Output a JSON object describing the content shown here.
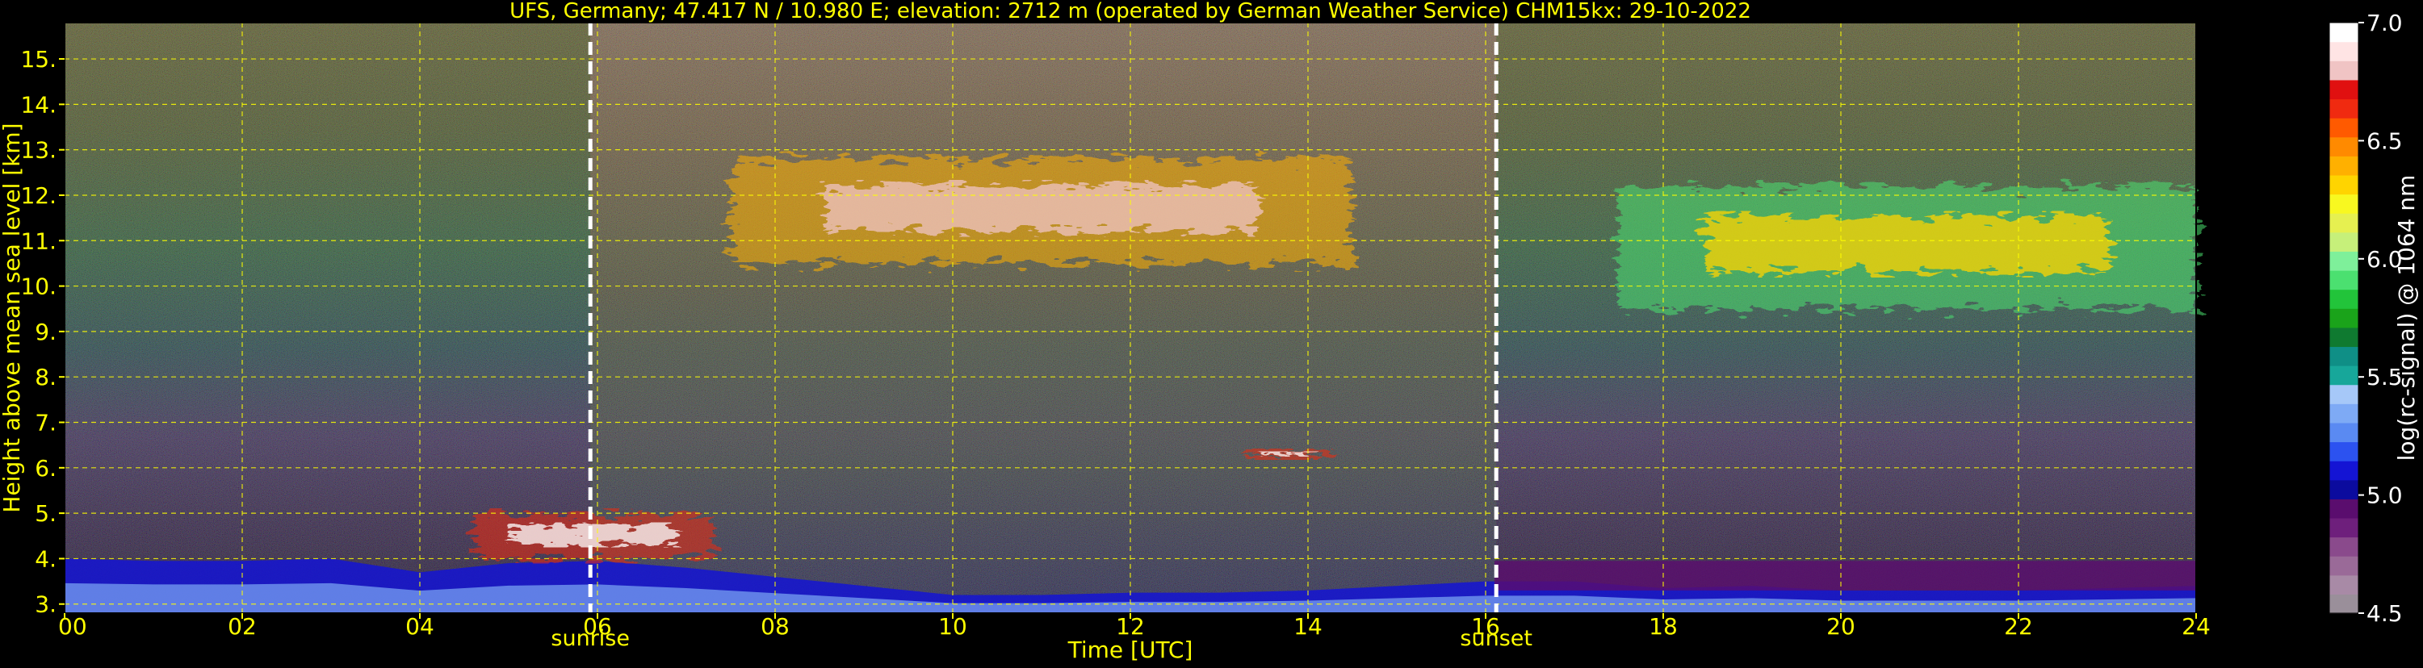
{
  "chart_data": {
    "type": "heatmap",
    "title": "UFS, Germany; 47.417 N / 10.980 E; elevation: 2712 m  (operated by German Weather Service)    CHM15kx: 29-10-2022",
    "xlabel": "Time [UTC]",
    "ylabel": "Height above mean sea level [km]",
    "xlim": [
      0,
      24
    ],
    "ylim": [
      2.8,
      15.8
    ],
    "x_ticks": [
      "00",
      "02",
      "04",
      "06",
      "08",
      "10",
      "12",
      "14",
      "16",
      "18",
      "20",
      "22",
      "24"
    ],
    "y_ticks": [
      "3.",
      "4.",
      "5.",
      "6.",
      "7.",
      "8.",
      "9.",
      "10.",
      "11.",
      "12.",
      "13.",
      "14.",
      "15."
    ],
    "grid": true,
    "markers": [
      {
        "label": "sunrise",
        "x": 5.92
      },
      {
        "label": "sunset",
        "x": 16.12
      }
    ],
    "colorbar": {
      "label": "log(rc-signal) @ 1064 nm",
      "range": [
        4.5,
        7.0
      ],
      "ticks": [
        "7.0",
        "6.5",
        "6.0",
        "5.5",
        "5.0",
        "4.5"
      ],
      "colors": [
        "#9a8f9a",
        "#a88aa6",
        "#9a6a98",
        "#8a4a8c",
        "#6e1f7c",
        "#5a0d6e",
        "#0b0b9e",
        "#1414d4",
        "#2c52f0",
        "#5a8af2",
        "#7eaaf5",
        "#a6c8f8",
        "#17a79a",
        "#0f8f86",
        "#0f7a30",
        "#1aa31a",
        "#22c43a",
        "#4be070",
        "#7ef09a",
        "#c6f07a",
        "#e6f050",
        "#f8f820",
        "#ffd400",
        "#ffb000",
        "#ff8a00",
        "#ff5a00",
        "#f02a10",
        "#e01010",
        "#f0c4c4",
        "#ffe4e4",
        "#ffffff"
      ]
    },
    "series": [
      {
        "x": [
          0,
          1,
          2,
          3,
          4,
          5,
          6,
          7,
          8,
          9,
          10,
          11,
          12,
          13,
          14,
          15,
          16,
          17,
          18,
          19,
          20,
          21,
          22,
          23,
          24
        ],
        "values": [
          4.0,
          3.95,
          3.95,
          4.0,
          3.7,
          3.9,
          3.95,
          3.8,
          3.6,
          3.4,
          3.2,
          3.2,
          3.25,
          3.25,
          3.3,
          3.4,
          3.5,
          3.5,
          3.35,
          3.4,
          3.3,
          3.3,
          3.3,
          3.35,
          3.4
        ]
      }
    ],
    "cloud_layers": [
      {
        "x_range": [
          17.5,
          24
        ],
        "y_range": [
          9.5,
          12.2
        ],
        "max": 6.3
      },
      {
        "x_range": [
          7.5,
          14.5
        ],
        "y_range": [
          10.5,
          12.8
        ],
        "max": 6.8
      },
      {
        "x_range": [
          4.6,
          7.3
        ],
        "y_range": [
          4.0,
          5.0
        ],
        "max": 7.0
      },
      {
        "x_range": [
          13.3,
          14.3
        ],
        "y_range": [
          6.2,
          6.4
        ],
        "max": 7.0
      }
    ]
  }
}
